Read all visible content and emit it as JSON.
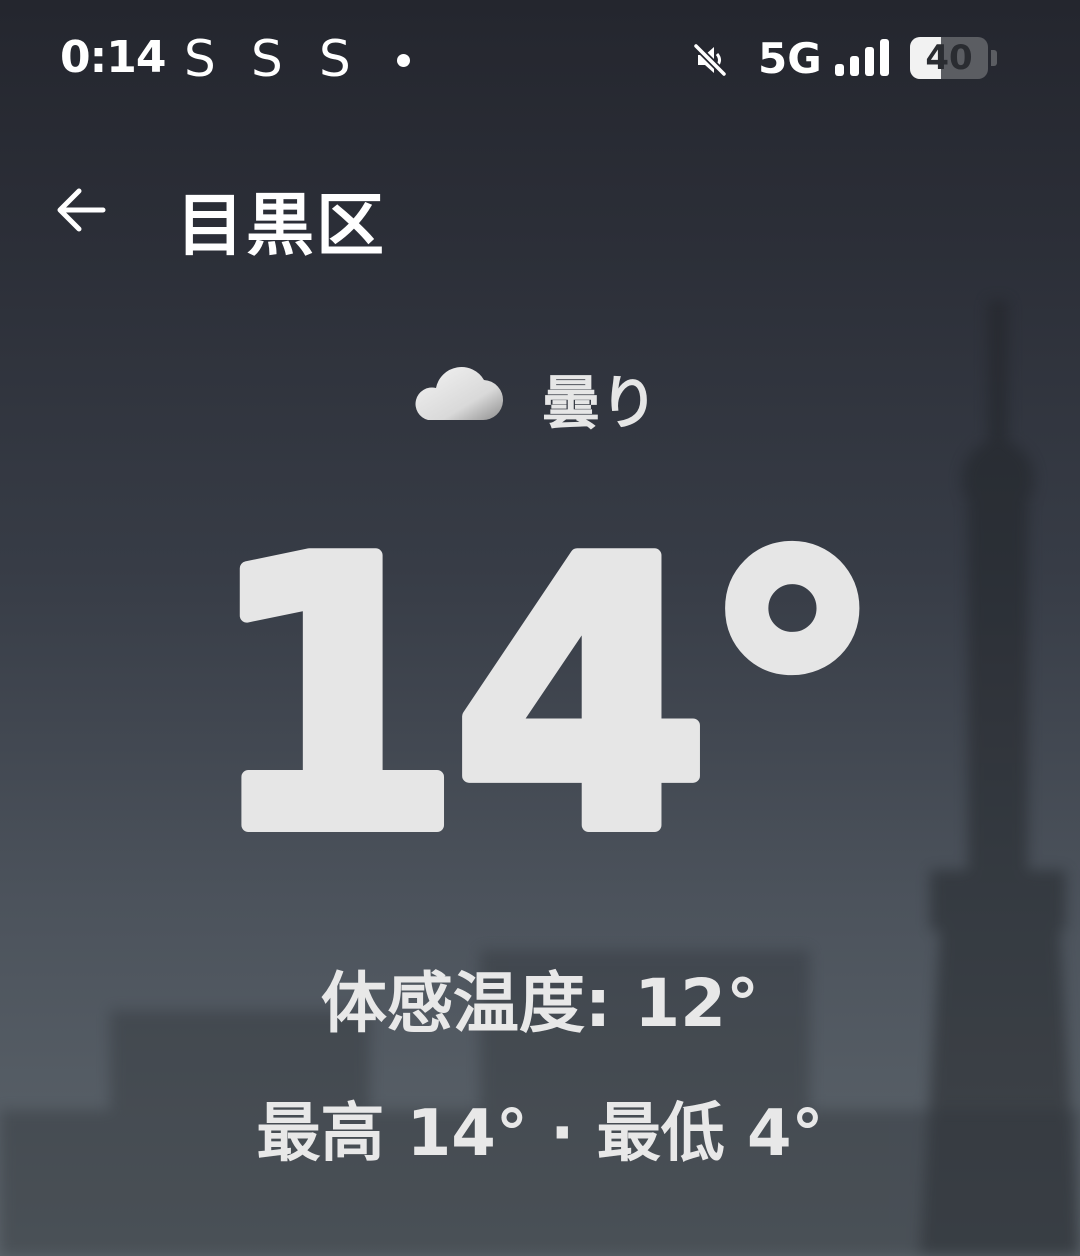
{
  "status_bar": {
    "time": "0:14",
    "notification_icons": [
      "S",
      "S",
      "S"
    ],
    "network": "5G",
    "battery_level": "40",
    "battery_fraction": 0.4,
    "icons": [
      "mute-icon",
      "signal-icon",
      "battery-icon"
    ]
  },
  "header": {
    "back_icon": "back-arrow-icon",
    "location": "目黒区"
  },
  "weather": {
    "condition": "曇り",
    "condition_icon": "cloud-icon",
    "temperature": "14°",
    "feels_like": "体感温度: 12°",
    "high_low": "最高 14° · 最低 4°"
  },
  "colors": {
    "text": "#ffffff",
    "temperature": "#e6e6e6",
    "background_top": "#24262e",
    "background_bottom": "#5d656c"
  }
}
